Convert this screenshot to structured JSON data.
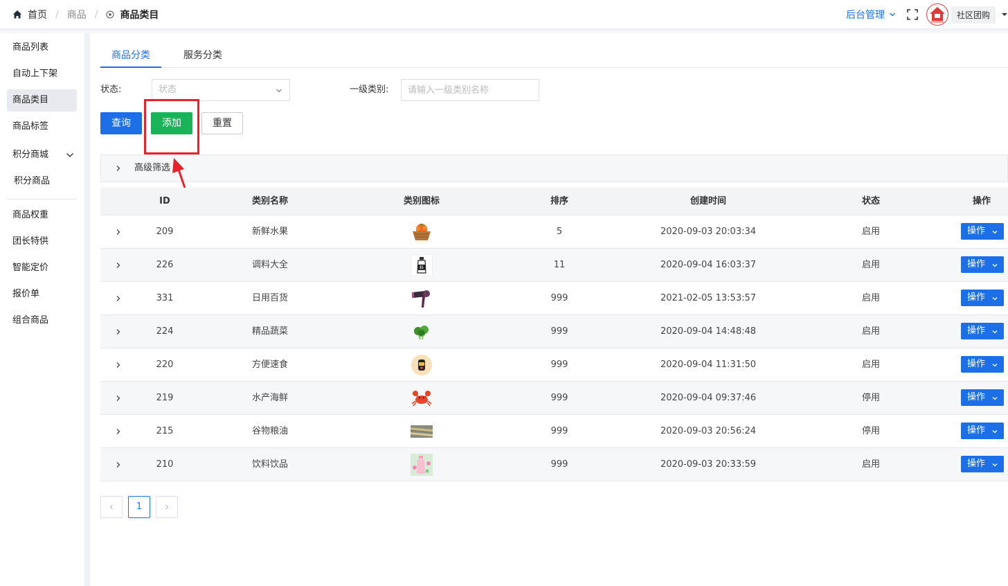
{
  "header": {
    "breadcrumb": [
      "首页",
      "商品",
      "商品类目"
    ],
    "admin_menu": "后台管理",
    "org_name": "社区团购"
  },
  "sidebar": {
    "items": [
      "商品列表",
      "自动上下架",
      "商品类目",
      "商品标签",
      "积分商城",
      "积分商品",
      "商品权重",
      "团长特供",
      "智能定价",
      "报价单",
      "组合商品"
    ],
    "active": "商品类目"
  },
  "tabs": [
    "商品分类",
    "服务分类"
  ],
  "filters": {
    "status_label": "状态:",
    "status_placeholder": "状态",
    "category_label": "一级类别:",
    "category_placeholder": "请输入一级类别名称"
  },
  "buttons": {
    "query": "查询",
    "add": "添加",
    "reset": "重置"
  },
  "advanced_filter": "高级筛选",
  "table": {
    "columns": [
      "ID",
      "类别名称",
      "类别图标",
      "排序",
      "创建时间",
      "状态",
      "操作"
    ],
    "rows": [
      {
        "id": "209",
        "name": "新鲜水果",
        "icon": "fruit-basket-icon",
        "sort": "5",
        "created": "2020-09-03 20:03:34",
        "status": "启用",
        "action": "操作"
      },
      {
        "id": "226",
        "name": "调料大全",
        "icon": "seasoning-bottle-icon",
        "sort": "11",
        "created": "2020-09-04 16:03:37",
        "status": "启用",
        "action": "操作"
      },
      {
        "id": "331",
        "name": "日用百货",
        "icon": "hair-dryer-icon",
        "sort": "999",
        "created": "2021-02-05 13:53:57",
        "status": "启用",
        "action": "操作"
      },
      {
        "id": "224",
        "name": "精品蔬菜",
        "icon": "vegetable-icon",
        "sort": "999",
        "created": "2020-09-04 14:48:48",
        "status": "启用",
        "action": "操作"
      },
      {
        "id": "220",
        "name": "方便速食",
        "icon": "instant-food-icon",
        "sort": "999",
        "created": "2020-09-04 11:31:50",
        "status": "启用",
        "action": "操作"
      },
      {
        "id": "219",
        "name": "水产海鲜",
        "icon": "crab-icon",
        "sort": "999",
        "created": "2020-09-04 09:37:46",
        "status": "停用",
        "action": "操作"
      },
      {
        "id": "215",
        "name": "谷物粮油",
        "icon": "grain-icon",
        "sort": "999",
        "created": "2020-09-03 20:56:24",
        "status": "停用",
        "action": "操作"
      },
      {
        "id": "210",
        "name": "饮料饮品",
        "icon": "drink-icon",
        "sort": "999",
        "created": "2020-09-03 20:33:59",
        "status": "启用",
        "action": "操作"
      }
    ]
  },
  "pagination": {
    "current": "1"
  },
  "colors": {
    "primary": "#1d6fe8",
    "add_green": "#19b35a",
    "annotation_red": "#e8212b"
  }
}
